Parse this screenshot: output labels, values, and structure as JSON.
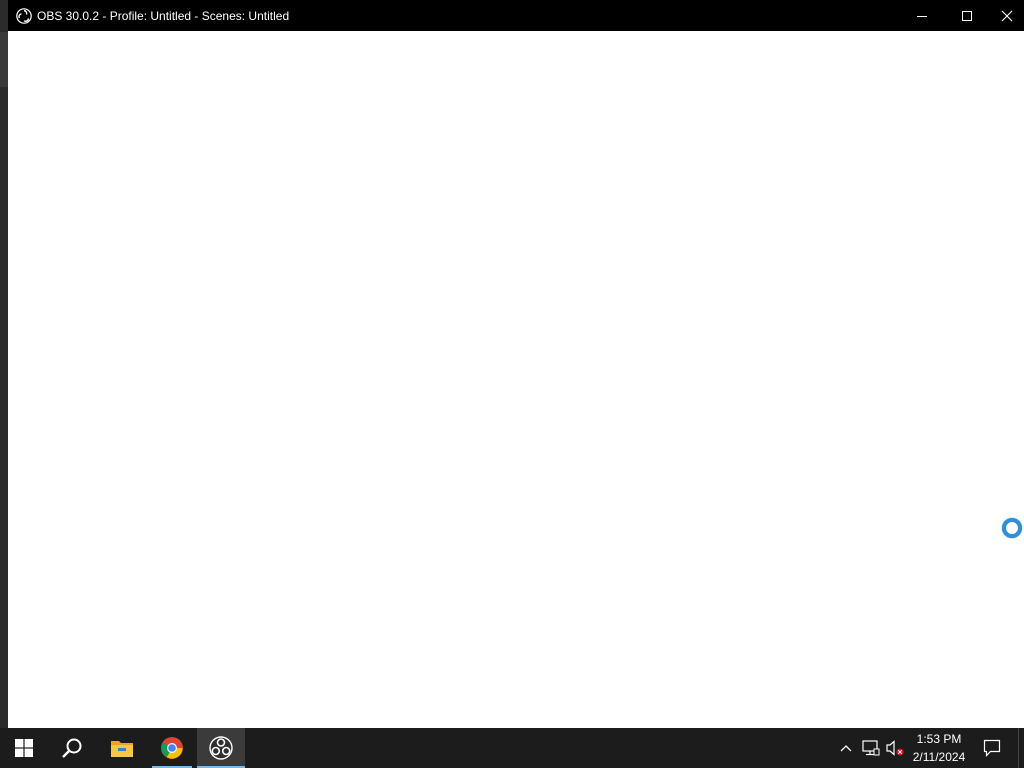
{
  "window": {
    "title": "OBS 30.0.2 - Profile: Untitled - Scenes: Untitled",
    "app_icon": "obs-icon",
    "controls": {
      "minimize_icon": "minimize-icon",
      "maximize_icon": "maximize-icon",
      "close_icon": "close-icon"
    }
  },
  "cursor": {
    "icon": "busy-spinner-icon",
    "color": "#2f8fd8"
  },
  "taskbar": {
    "items": [
      {
        "name": "start",
        "icon": "windows-start-icon"
      },
      {
        "name": "search",
        "icon": "search-icon"
      },
      {
        "name": "file-explorer",
        "icon": "folder-icon"
      },
      {
        "name": "chrome",
        "icon": "chrome-icon"
      },
      {
        "name": "obs",
        "icon": "obs-icon",
        "active": true
      }
    ],
    "tray": {
      "chevron_icon": "chevron-up-icon",
      "network_icon": "network-icon",
      "volume_icon": "volume-muted-icon"
    },
    "clock": {
      "time": "1:53 PM",
      "date": "2/11/2024"
    },
    "notification_icon": "notification-icon",
    "accent": "#76b9ed"
  }
}
